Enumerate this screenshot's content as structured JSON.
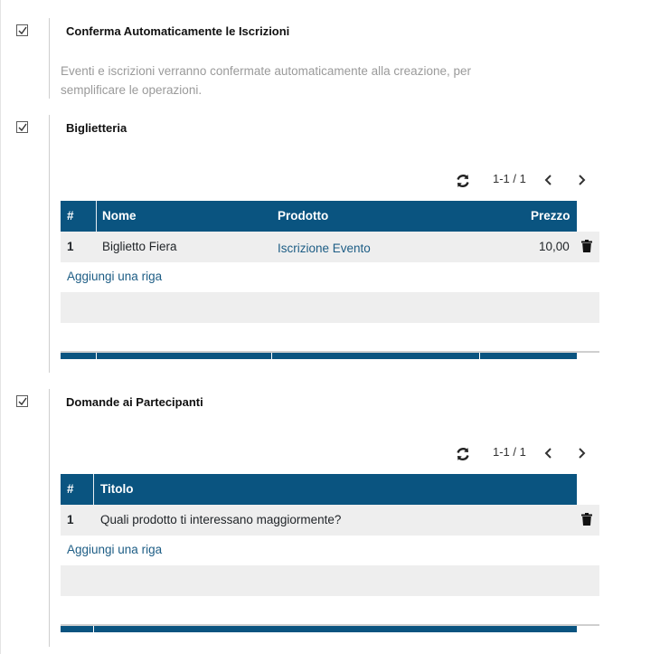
{
  "sections": [
    {
      "title": "Conferma Automaticamente le Iscrizioni",
      "checked": true,
      "description": "Eventi e iscrizioni verranno confermate automaticamente alla creazione, per semplificare le operazioni."
    },
    {
      "title": "Biglietteria",
      "checked": true,
      "pager": {
        "count": "1-1 / 1"
      },
      "table": {
        "headers": {
          "num": "#",
          "name": "Nome",
          "product": "Prodotto",
          "price": "Prezzo"
        },
        "rows": [
          {
            "num": "1",
            "name": "Biglietto Fiera",
            "product": "Iscrizione Evento",
            "price": "10,00"
          }
        ],
        "add_row": "Aggiungi una riga"
      }
    },
    {
      "title": "Domande ai Partecipanti",
      "checked": true,
      "pager": {
        "count": "1-1 / 1"
      },
      "table": {
        "headers": {
          "num": "#",
          "title": "Titolo"
        },
        "rows": [
          {
            "num": "1",
            "title": "Quali prodotto ti interessano maggiormente?"
          }
        ],
        "add_row": "Aggiungi una riga"
      }
    }
  ],
  "colors": {
    "header": "#0a5480",
    "link": "#1d5d85",
    "row_grey": "#eeeeee"
  },
  "icons": [
    "checkbox-checked-icon",
    "refresh-icon",
    "chevron-left-icon",
    "chevron-right-icon",
    "trash-icon"
  ]
}
